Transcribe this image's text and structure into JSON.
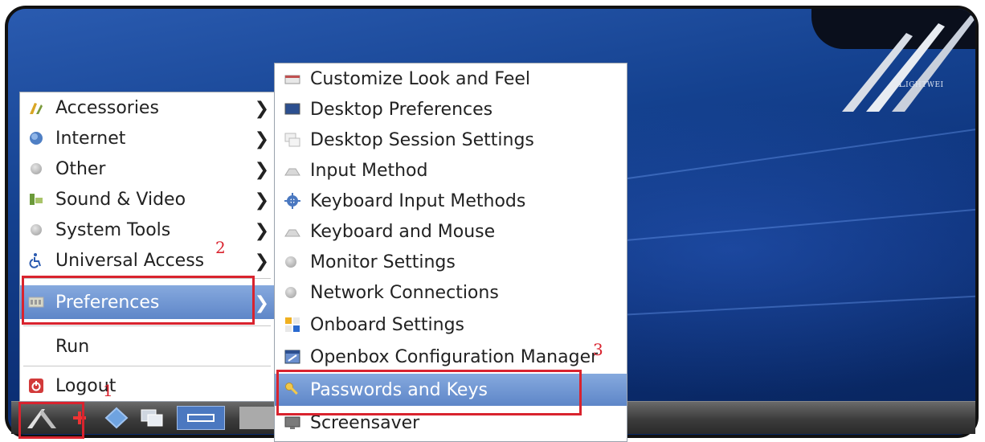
{
  "desktop": {
    "logo_text": "Lightwei"
  },
  "main_menu": {
    "items": [
      {
        "label": "Accessories",
        "icon": "accessories-icon",
        "has_submenu": true
      },
      {
        "label": "Internet",
        "icon": "globe-icon",
        "has_submenu": true
      },
      {
        "label": "Other",
        "icon": "other-icon",
        "has_submenu": true
      },
      {
        "label": "Sound & Video",
        "icon": "sound-video-icon",
        "has_submenu": true
      },
      {
        "label": "System Tools",
        "icon": "system-tools-icon",
        "has_submenu": true
      },
      {
        "label": "Universal Access",
        "icon": "accessibility-icon",
        "has_submenu": true
      },
      {
        "label": "Preferences",
        "icon": "preferences-icon",
        "has_submenu": true,
        "selected": true
      },
      {
        "label": "Run",
        "icon": "",
        "has_submenu": false
      },
      {
        "label": "Logout",
        "icon": "logout-icon",
        "has_submenu": false
      }
    ],
    "arrow": "❯"
  },
  "preferences_submenu": {
    "items": [
      {
        "label": "Customize Look and Feel",
        "icon": "appearance-icon"
      },
      {
        "label": "Desktop Preferences",
        "icon": "monitor-icon"
      },
      {
        "label": "Desktop Session Settings",
        "icon": "session-icon"
      },
      {
        "label": "Input Method",
        "icon": "input-method-icon"
      },
      {
        "label": "Keyboard Input Methods",
        "icon": "keyboard-gear-icon"
      },
      {
        "label": "Keyboard and Mouse",
        "icon": "keyboard-mouse-icon"
      },
      {
        "label": "Monitor Settings",
        "icon": "monitor-settings-icon"
      },
      {
        "label": "Network Connections",
        "icon": "network-icon"
      },
      {
        "label": "Onboard Settings",
        "icon": "onboard-icon"
      },
      {
        "label": "Openbox Configuration Manager",
        "icon": "openbox-icon"
      },
      {
        "label": "Passwords and Keys",
        "icon": "key-icon",
        "selected": true
      },
      {
        "label": "Screensaver",
        "icon": "screensaver-icon"
      }
    ]
  },
  "annotations": {
    "step1": "1",
    "step2": "2",
    "step3": "3"
  },
  "colors": {
    "highlight": "#6f95d2",
    "annotation_red": "#d9232e",
    "desktop_blue": "#14418f"
  }
}
